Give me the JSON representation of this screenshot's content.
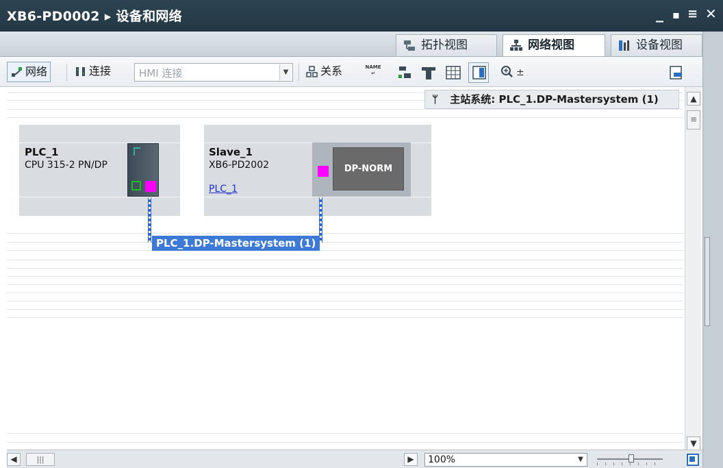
{
  "window": {
    "title": "XB6-PD0002 ▸ 设备和网络",
    "controls": [
      "_",
      "▪",
      "≡",
      "✕"
    ]
  },
  "view_tabs": [
    {
      "label": "拓扑视图",
      "icon": "topology-view-icon",
      "active": false
    },
    {
      "label": "网络视图",
      "icon": "network-view-icon",
      "active": true
    },
    {
      "label": "设备视图",
      "icon": "device-view-icon",
      "active": false
    }
  ],
  "toolbar": {
    "network_label": "网络",
    "connect_label": "连接",
    "hmi_connection_value": "HMI 连接",
    "relations_label": "关系",
    "name_icon_text": "NAME"
  },
  "master_system_tip": {
    "label": "主站系统:",
    "value": "PLC_1.DP-Mastersystem (1)"
  },
  "devices": [
    {
      "name": "PLC_1",
      "type": "CPU 315-2 PN/DP"
    },
    {
      "name": "Slave_1",
      "type": "XB6-PD2002",
      "link": "PLC_1",
      "module_label": "DP-NORM"
    }
  ],
  "bus": {
    "label": "PLC_1.DP-Mastersystem (1)",
    "color": "#3d7ad8"
  },
  "status_bar": {
    "zoom": "100%"
  },
  "colors": {
    "title_bar": "#2e4453",
    "bus_blue": "#2f6ad1",
    "port_magenta": "#ff00ff",
    "port_green": "#19c219",
    "device_bg": "#d9dde2"
  }
}
